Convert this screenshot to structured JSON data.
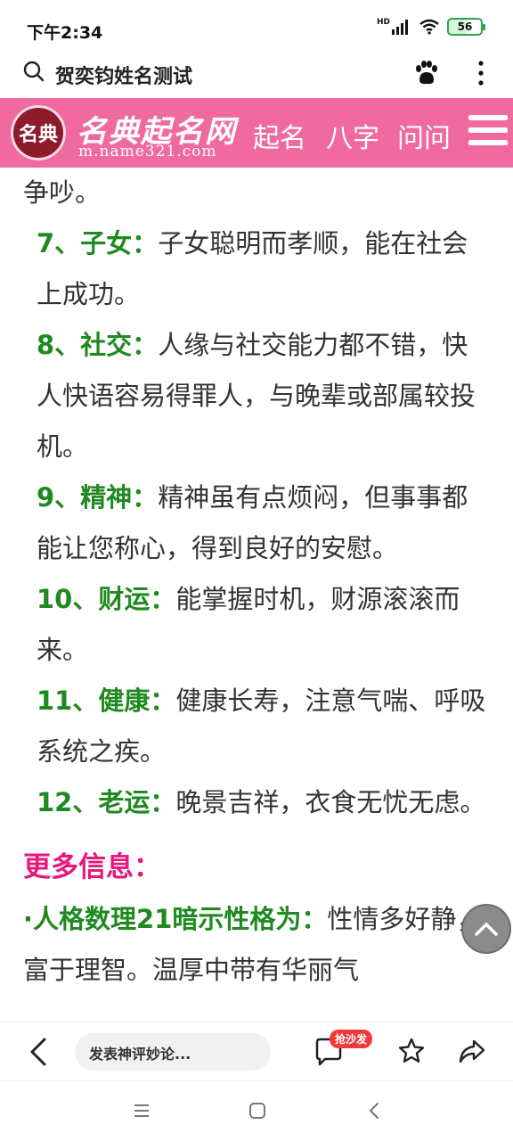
{
  "status_bar": {
    "time": "下午2:34",
    "network_label": "HD",
    "battery_level": "56"
  },
  "browser": {
    "search_text": "贺奕钧姓名测试"
  },
  "site": {
    "logo_glyphs": "名典",
    "logo_title": "名典起名网",
    "logo_url": "m.name321.com",
    "nav": [
      "起名",
      "八字",
      "问问"
    ]
  },
  "article": {
    "lead_text": "争吵。",
    "items": [
      {
        "label": "7、子女：",
        "text": "子女聪明而孝顺，能在社会上成功。"
      },
      {
        "label": "8、社交：",
        "text": "人缘与社交能力都不错，快人快语容易得罪人，与晚辈或部属较投机。"
      },
      {
        "label": "9、精神：",
        "text": "精神虽有点烦闷，但事事都能让您称心，得到良好的安慰。"
      },
      {
        "label": "10、财运：",
        "text": "能掌握时机，财源滚滚而来。"
      },
      {
        "label": "11、健康：",
        "text": "健康长寿，注意气喘、呼吸系统之疾。"
      },
      {
        "label": "12、老运：",
        "text": "晚景吉祥，衣食无忧无虑。"
      }
    ],
    "more_heading": "更多信息：",
    "more_item": {
      "label": "·人格数理21暗示性格为：",
      "text": "性情多好静，富于理智。温厚中带有华丽气"
    }
  },
  "toolbar": {
    "comment_placeholder": "发表神评妙论...",
    "badge": "抢沙发"
  },
  "colors": {
    "header_pink": "#f06aa0",
    "label_green": "#1f8a1f",
    "heading_magenta": "#e6197e"
  }
}
